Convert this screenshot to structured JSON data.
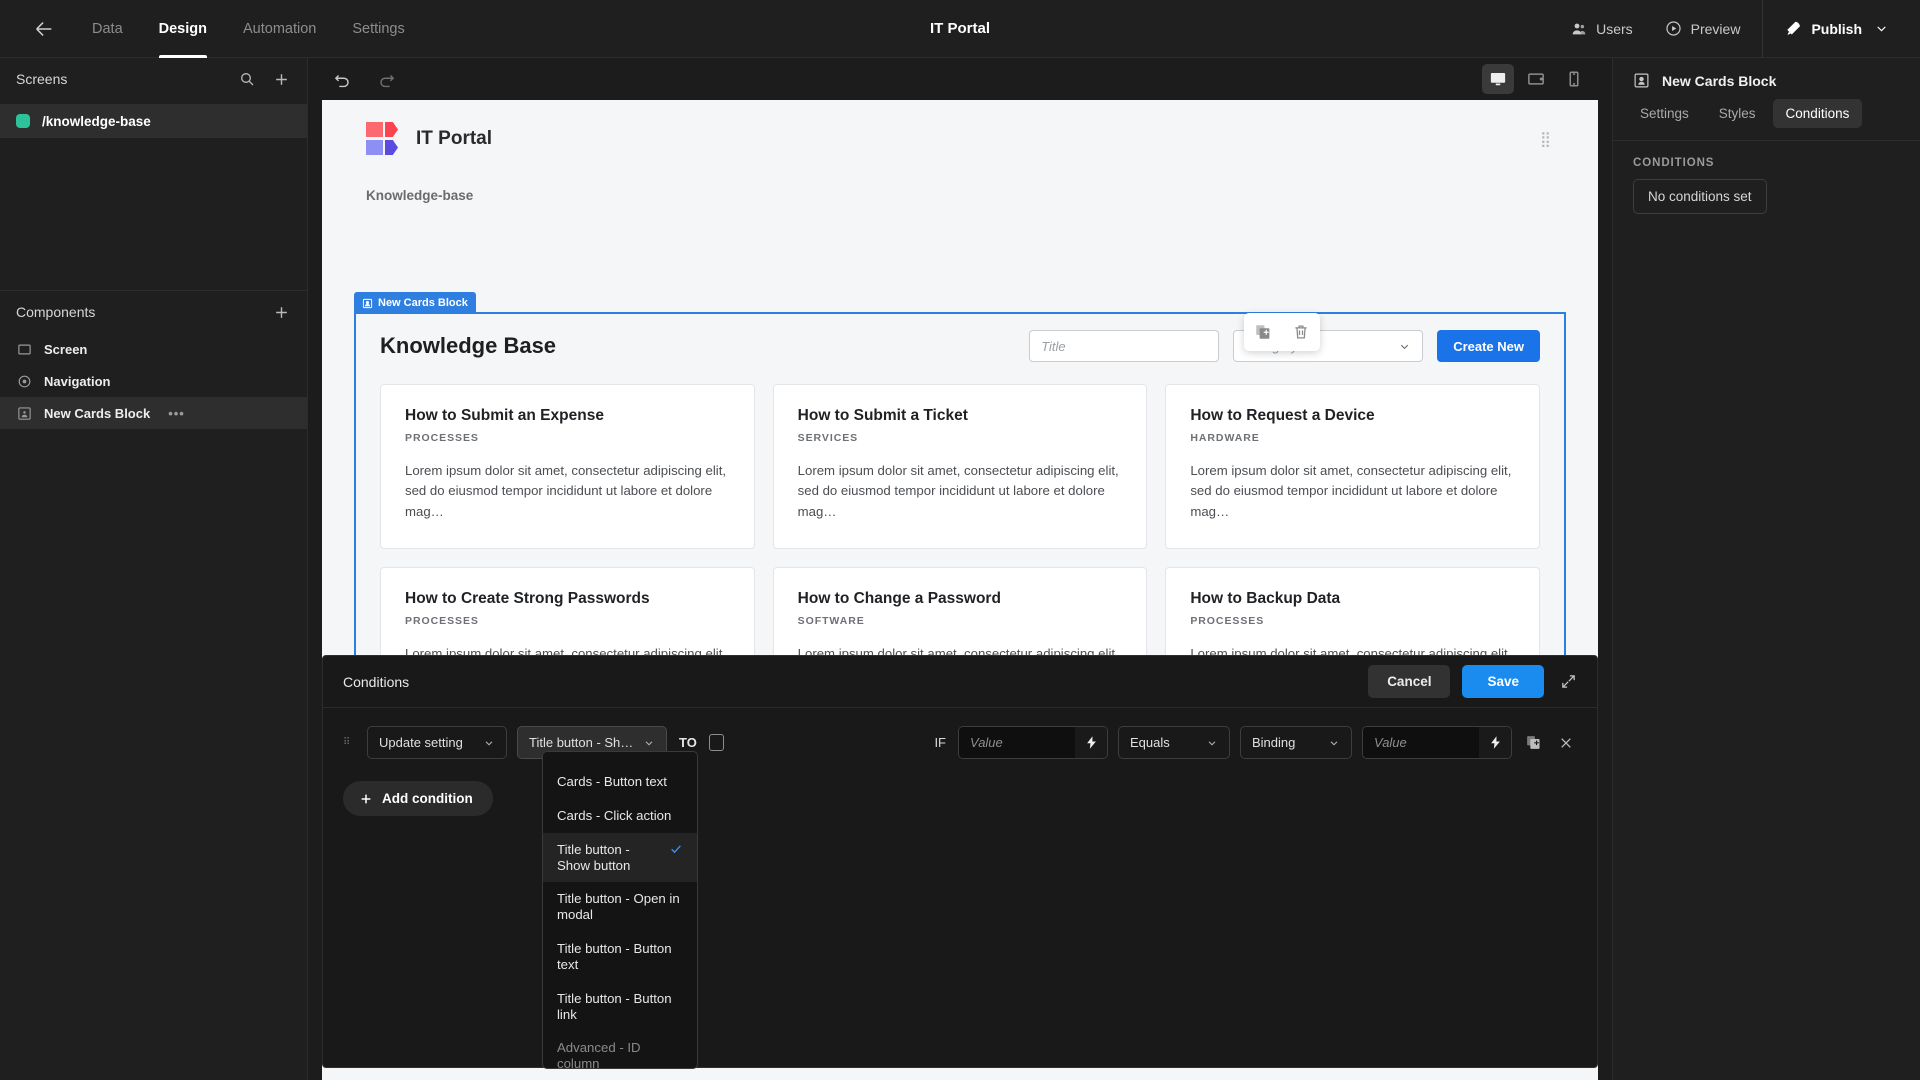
{
  "topbar": {
    "back_icon": "arrow-left-icon",
    "nav": [
      {
        "label": "Data",
        "active": false
      },
      {
        "label": "Design",
        "active": true
      },
      {
        "label": "Automation",
        "active": false
      },
      {
        "label": "Settings",
        "active": false
      }
    ],
    "app_title": "IT Portal",
    "users_label": "Users",
    "preview_label": "Preview",
    "publish_label": "Publish"
  },
  "sidebar": {
    "screens_title": "Screens",
    "screens": [
      {
        "label": "/knowledge-base",
        "dot_color": "#2ec29a",
        "selected": true
      }
    ],
    "components_title": "Components",
    "components": [
      {
        "label": "Screen",
        "icon": "screen-icon",
        "selected": false,
        "more": ""
      },
      {
        "label": "Navigation",
        "icon": "navigation-icon",
        "selected": false,
        "more": ""
      },
      {
        "label": "New Cards Block",
        "icon": "cards-block-icon",
        "selected": true,
        "more": "•••"
      }
    ]
  },
  "canvas": {
    "devices": [
      {
        "name": "desktop-view",
        "active": true
      },
      {
        "name": "tablet-view",
        "active": false
      },
      {
        "name": "mobile-view",
        "active": false
      }
    ],
    "page": {
      "brand_title": "IT Portal",
      "breadcrumb": "Knowledge-base",
      "block_tag": "New Cards Block",
      "kb_title": "Knowledge Base",
      "title_placeholder": "Title",
      "title_value": "",
      "category_placeholder": "Category",
      "category_value": "",
      "create_button": "Create New",
      "cards": [
        {
          "title": "How to Submit an Expense",
          "category": "PROCESSES",
          "body": "Lorem ipsum dolor sit amet, consectetur adipiscing elit, sed do eiusmod tempor incididunt ut labore et dolore mag…"
        },
        {
          "title": "How to Submit a Ticket",
          "category": "SERVICES",
          "body": "Lorem ipsum dolor sit amet, consectetur adipiscing elit, sed do eiusmod tempor incididunt ut labore et dolore mag…"
        },
        {
          "title": "How to Request a Device",
          "category": "HARDWARE",
          "body": "Lorem ipsum dolor sit amet, consectetur adipiscing elit, sed do eiusmod tempor incididunt ut labore et dolore mag…"
        },
        {
          "title": "How to Create Strong Passwords",
          "category": "PROCESSES",
          "body": "Lorem ipsum dolor sit amet, consectetur adipiscing elit, sed do eiusmod tempor incididunt ut labore et dolore mag…"
        },
        {
          "title": "How to Change a Password",
          "category": "SOFTWARE",
          "body": "Lorem ipsum dolor sit amet, consectetur adipiscing elit, sed do eiusmod tempor incididunt ut labore et dolore mag…"
        },
        {
          "title": "How to Backup Data",
          "category": "PROCESSES",
          "body": "Lorem ipsum dolor sit amet, consectetur adipiscing elit, sed do eiusmod tempor incididunt ut labore et dolore mag…"
        }
      ]
    }
  },
  "rightpanel": {
    "title": "New Cards Block",
    "tabs": [
      {
        "label": "Settings",
        "active": false
      },
      {
        "label": "Styles",
        "active": false
      },
      {
        "label": "Conditions",
        "active": true
      }
    ],
    "section_label": "CONDITIONS",
    "empty_state": "No conditions set"
  },
  "drawer": {
    "title": "Conditions",
    "cancel_label": "Cancel",
    "save_label": "Save",
    "condition": {
      "action_value": "Update setting",
      "setting_value": "Title button - Sh…",
      "to_label": "TO",
      "to_checked": false,
      "if_label": "IF",
      "left_value_placeholder": "Value",
      "left_value": "",
      "operator_value": "Equals",
      "source_value": "Binding",
      "right_value_placeholder": "Value",
      "right_value": ""
    },
    "add_condition_label": "Add condition",
    "dropdown": {
      "items": [
        {
          "label": "Cards - Button text",
          "selected": false
        },
        {
          "label": "Cards - Click action",
          "selected": false
        },
        {
          "label": "Title button - Show button",
          "selected": true
        },
        {
          "label": "Title button - Open in modal",
          "selected": false
        },
        {
          "label": "Title button - Button text",
          "selected": false
        },
        {
          "label": "Title button - Button link",
          "selected": false
        },
        {
          "label": "Advanced - ID column",
          "selected": false
        }
      ]
    }
  },
  "colors": {
    "accent_blue": "#1a8cf0",
    "brand_blue": "#1a73e8",
    "selection_blue": "#2f7fe0",
    "screen_dot_green": "#2ec29a"
  }
}
